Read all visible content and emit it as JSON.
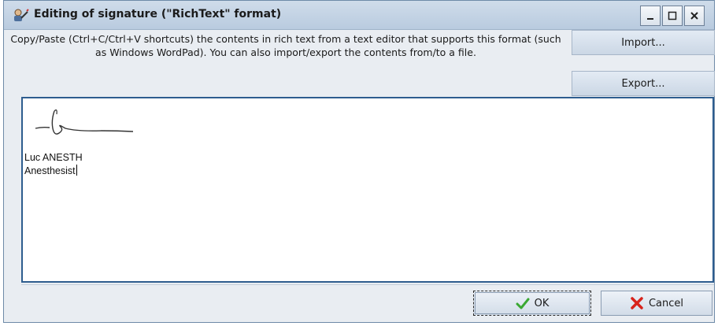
{
  "window": {
    "title": "Editing of signature (\"RichText\" format)"
  },
  "title_buttons": {
    "minimize_icon": "minimize-icon",
    "maximize_icon": "maximize-icon",
    "close_icon": "close-icon"
  },
  "header": {
    "instructions": "Copy/Paste (Ctrl+C/Ctrl+V shortcuts) the contents in rich text from a text editor that supports this format (such as Windows WordPad). You can also import/export the contents from/to a file.",
    "import_label": "Import...",
    "export_label": "Export..."
  },
  "editor": {
    "signer_name": "Luc ANESTH",
    "signer_role": "Anesthesist"
  },
  "footer": {
    "ok_label": "OK",
    "cancel_label": "Cancel"
  },
  "colors": {
    "titlebar": "#c4d4e6",
    "editor_border": "#2e5d8f",
    "ok_check": "#3aa832",
    "cancel_x": "#d8231b"
  }
}
